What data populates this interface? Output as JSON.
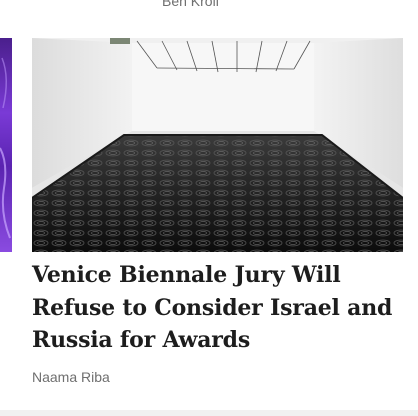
{
  "previous_card": {
    "author": "Ben Kroll"
  },
  "article": {
    "headline": "Venice Biennale Jury Will Refuse to Consider Israel and Russia for Awards",
    "author": "Naama Riba",
    "image_description": "installation-gallery-image"
  },
  "colors": {
    "headline": "#1d1d1d",
    "byline": "#6f6f6f",
    "thumb_purple": "#6a2fc0"
  }
}
